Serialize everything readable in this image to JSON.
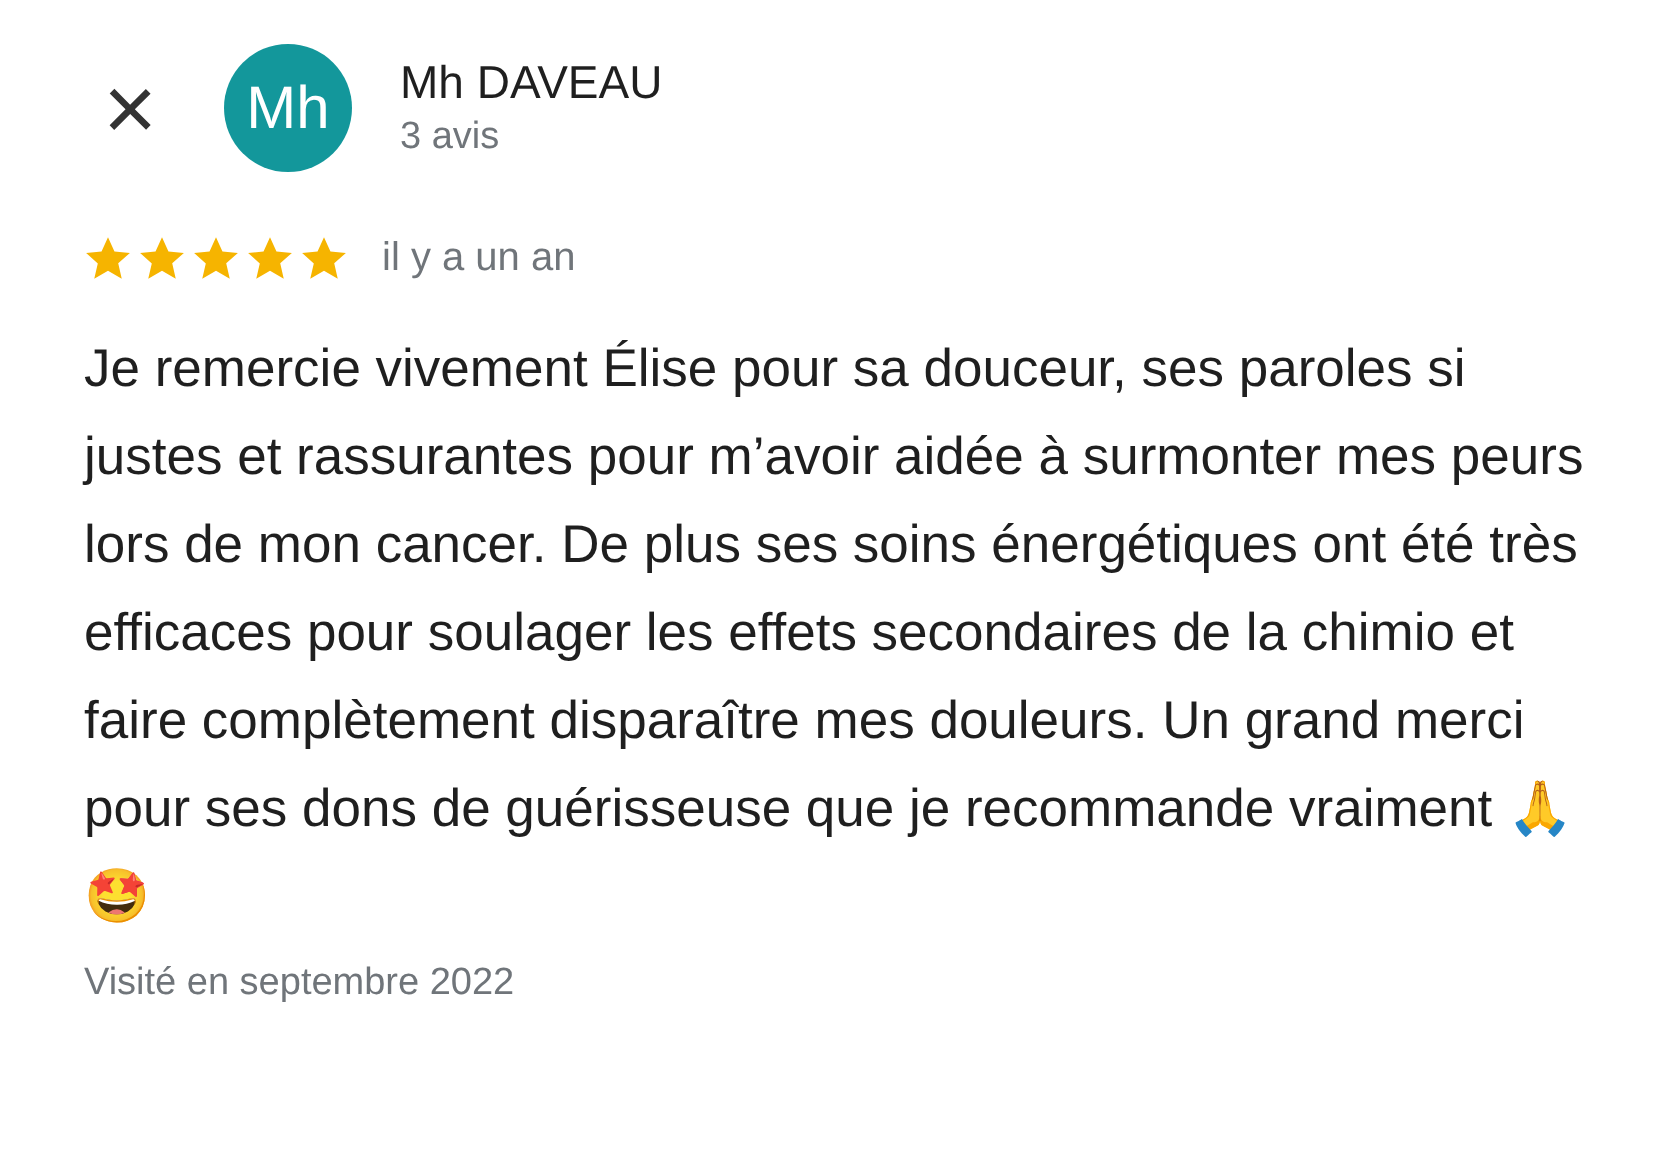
{
  "header": {
    "close": "×",
    "avatar": "Mh",
    "name": "Mh DAVEAU",
    "review_count": "3 avis"
  },
  "review": {
    "stars": 5,
    "time": "il y a un an",
    "text": "Je remercie vivement Élise pour sa douceur, ses paroles si justes et rassurantes pour m’avoir aidée à surmonter mes peurs lors de mon cancer. De plus ses soins énergétiques ont été très efficaces pour soulager les effets secondaires de la chimio et faire complètement disparaître mes douleurs. Un grand merci pour ses dons de guérisseuse que je recommande vraiment 🙏🤩",
    "visited": "Visité en septembre 2022"
  }
}
